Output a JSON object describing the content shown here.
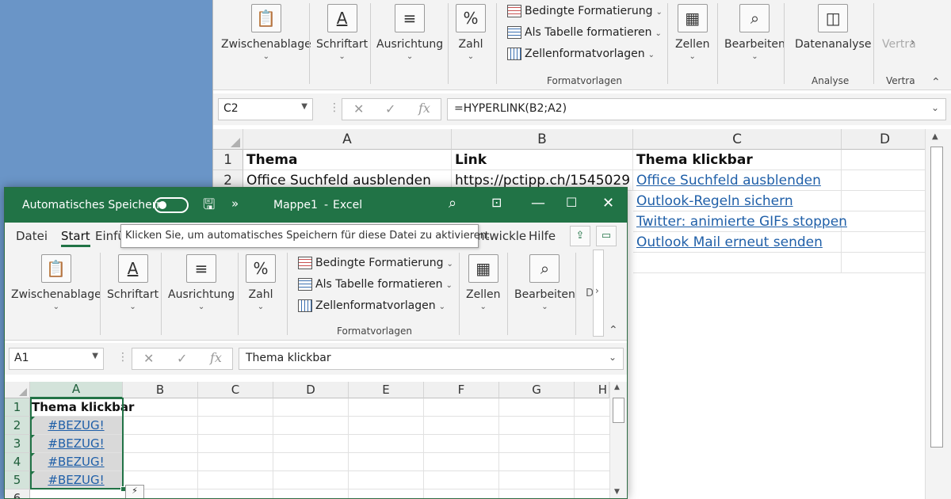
{
  "back": {
    "ribbon": {
      "clipboard": "Zwischenablage",
      "font": "Schriftart",
      "alignment": "Ausrichtung",
      "number": "Zahl",
      "cond_format": "Bedingte Formatierung",
      "as_table": "Als Tabelle formatieren",
      "cell_styles": "Zellenformatvorlagen",
      "styles_group": "Formatvorlagen",
      "cells": "Zellen",
      "edit": "Bearbeiten",
      "data_analysis": "Datenanalyse",
      "analysis_group": "Analyse",
      "vertra_top": "Vertra",
      "vertra_bottom": "Vertra"
    },
    "namebox": "C2",
    "formula": "=HYPERLINK(B2;A2)",
    "columns": [
      "A",
      "B",
      "C",
      "D"
    ],
    "rows": [
      "1",
      "2"
    ],
    "cells": {
      "a1": "Thema",
      "b1": "Link",
      "c1": "Thema klickbar",
      "a2": "Office Suchfeld ausblenden",
      "b2": "https://pctipp.ch/1545029",
      "c2": "Office Suchfeld ausblenden",
      "c3": "Outlook-Regeln sichern",
      "c4": "Twitter: animierte GIFs stoppen",
      "c5": "Outlook Mail erneut senden"
    }
  },
  "front": {
    "title": {
      "autosave": "Automatisches Speichern",
      "filename": "Mappe1",
      "separator": "-",
      "app": "Excel"
    },
    "menu": {
      "datei": "Datei",
      "start": "Start",
      "einfuegen": "Einfü",
      "entwickler": "ntwickle",
      "hilfe": "Hilfe"
    },
    "tooltip": "Klicken Sie, um automatisches Speichern für diese Datei zu aktivieren.",
    "ribbon": {
      "clipboard": "Zwischenablage",
      "font": "Schriftart",
      "alignment": "Ausrichtung",
      "number": "Zahl",
      "cond_format": "Bedingte Formatierung",
      "as_table": "Als Tabelle formatieren",
      "cell_styles": "Zellenformatvorlagen",
      "styles_group": "Formatvorlagen",
      "cells": "Zellen",
      "edit": "Bearbeiten",
      "cut": "D"
    },
    "namebox": "A1",
    "formula": "Thema klickbar",
    "columns": [
      "A",
      "B",
      "C",
      "D",
      "E",
      "F",
      "G",
      "H"
    ],
    "rows": [
      "1",
      "2",
      "3",
      "4",
      "5",
      "6"
    ],
    "cells": {
      "a1": "Thema klickbar",
      "a2": "#BEZUG!",
      "a3": "#BEZUG!",
      "a4": "#BEZUG!",
      "a5": "#BEZUG!"
    }
  },
  "icons": {
    "clipboard": "clipboard-icon",
    "font": "font-icon",
    "align": "align-icon",
    "percent": "percent-icon",
    "cells": "table-cells-icon",
    "search": "search-icon",
    "analysis": "data-analysis-icon"
  }
}
